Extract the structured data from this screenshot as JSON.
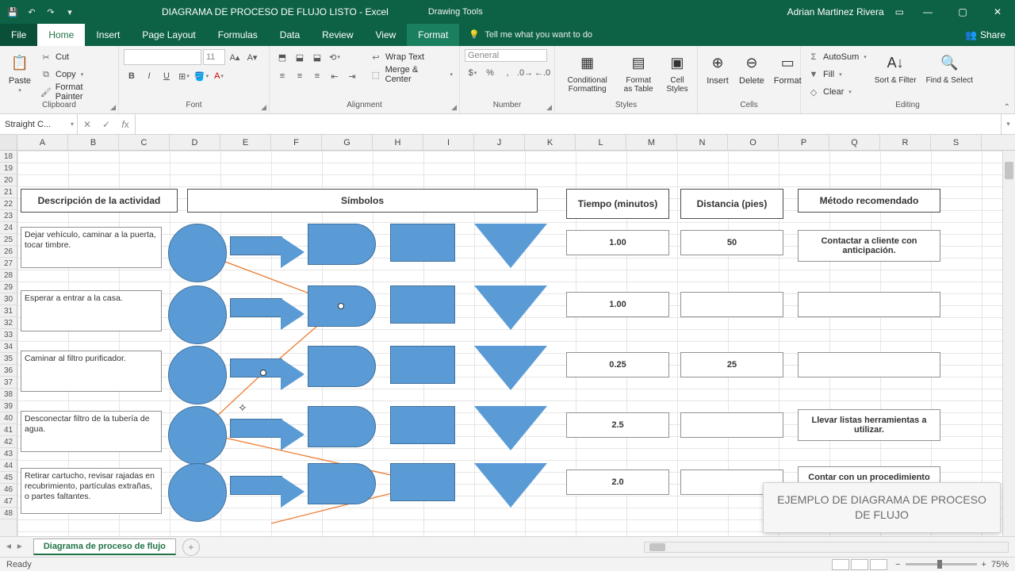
{
  "titlebar": {
    "doc_title": "DIAGRAMA DE PROCESO DE FLUJO LISTO - Excel",
    "tool_context": "Drawing Tools",
    "user": "Adrian Martinez Rivera"
  },
  "tabs": {
    "file": "File",
    "home": "Home",
    "insert": "Insert",
    "page_layout": "Page Layout",
    "formulas": "Formulas",
    "data": "Data",
    "review": "Review",
    "view": "View",
    "format": "Format",
    "tell_me": "Tell me what you want to do",
    "share": "Share"
  },
  "ribbon": {
    "clipboard": {
      "group": "Clipboard",
      "paste": "Paste",
      "cut": "Cut",
      "copy": "Copy",
      "format_painter": "Format Painter"
    },
    "font": {
      "group": "Font",
      "font_name": "",
      "font_size": "11"
    },
    "alignment": {
      "group": "Alignment",
      "wrap": "Wrap Text",
      "merge": "Merge & Center"
    },
    "number": {
      "group": "Number",
      "format": "General"
    },
    "styles": {
      "group": "Styles",
      "cond": "Conditional Formatting",
      "table": "Format as Table",
      "cell": "Cell Styles"
    },
    "cells": {
      "group": "Cells",
      "insert": "Insert",
      "delete": "Delete",
      "format": "Format"
    },
    "editing": {
      "group": "Editing",
      "autosum": "AutoSum",
      "fill": "Fill",
      "clear": "Clear",
      "sort": "Sort & Filter",
      "find": "Find & Select"
    }
  },
  "namebox": "Straight C...",
  "columns": [
    "A",
    "B",
    "C",
    "D",
    "E",
    "F",
    "G",
    "H",
    "I",
    "J",
    "K",
    "L",
    "M",
    "N",
    "O",
    "P",
    "Q",
    "R",
    "S"
  ],
  "row_start": 18,
  "row_end": 48,
  "headers": {
    "descripcion": "Descripción de la actividad",
    "simbolos": "Símbolos",
    "tiempo": "Tiempo (minutos)",
    "distancia": "Distancia (pies)",
    "metodo": "Método recomendado"
  },
  "rows": [
    {
      "desc": "Dejar vehículo, caminar a la puerta, tocar timbre.",
      "tiempo": "1.00",
      "dist": "50",
      "rec": "Contactar a cliente con anticipación."
    },
    {
      "desc": "Esperar a entrar a la casa.",
      "tiempo": "1.00",
      "dist": "",
      "rec": ""
    },
    {
      "desc": "Caminar al filtro purificador.",
      "tiempo": "0.25",
      "dist": "25",
      "rec": ""
    },
    {
      "desc": "Desconectar filtro de la tubería de agua.",
      "tiempo": "2.5",
      "dist": "",
      "rec": "Llevar listas herramientas a utilizar."
    },
    {
      "desc": "Retirar cartucho, revisar rajadas en recubrimiento, partículas extrañas, o partes faltantes.",
      "tiempo": "2.0",
      "dist": "",
      "rec": "Contar con un procedimiento establecido de revisión."
    }
  ],
  "sheet_tab": "Diagrama de proceso de flujo",
  "status": {
    "ready": "Ready",
    "zoom": "75%"
  },
  "tooltip": "EJEMPLO DE DIAGRAMA DE PROCESO DE FLUJO"
}
